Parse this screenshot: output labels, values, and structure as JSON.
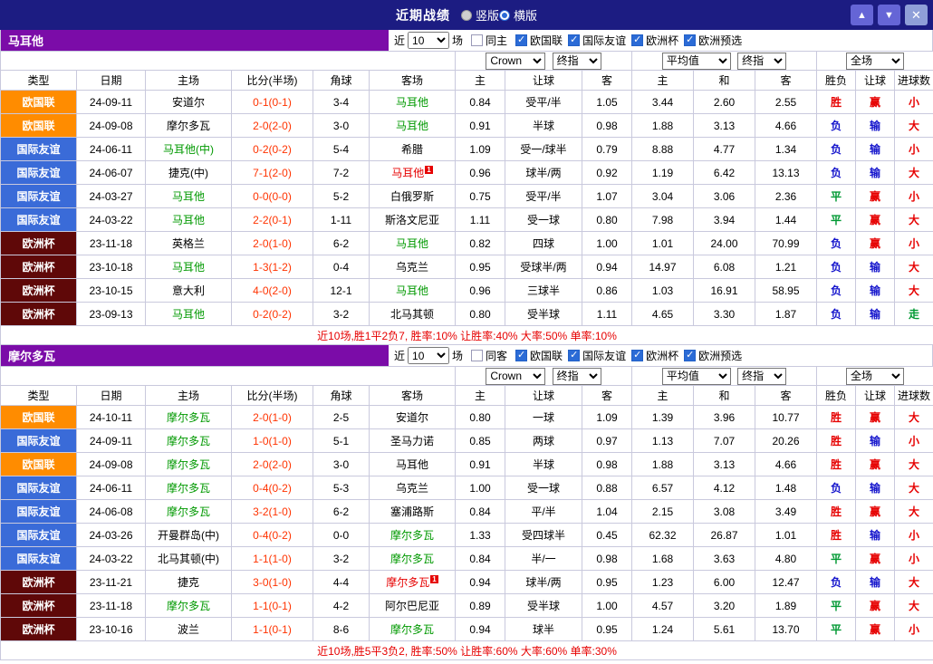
{
  "topbar": {
    "title": "近期战绩",
    "up_icon": "▲",
    "down_icon": "▼",
    "close_icon": "✕",
    "layout_options": [
      {
        "label": "竖版",
        "selected": false
      },
      {
        "label": "横版",
        "selected": true
      }
    ]
  },
  "table": {
    "columns": [
      "类型",
      "日期",
      "主场",
      "比分(半场)",
      "角球",
      "客场",
      "主",
      "让球",
      "客",
      "主",
      "和",
      "客",
      "胜负",
      "让球",
      "进球数"
    ],
    "selects": {
      "bookmaker": "Crown",
      "odds_stage": "终指",
      "average": "平均值",
      "average_stage": "终指",
      "scope": "全场"
    }
  },
  "sections": [
    {
      "team": "马耳他",
      "filter": {
        "near_label": "近",
        "count": "10",
        "unit_label": "场",
        "same_label": "同主",
        "same_checked": false,
        "leagues": [
          {
            "label": "欧国联",
            "checked": true
          },
          {
            "label": "国际友谊",
            "checked": true
          },
          {
            "label": "欧洲杯",
            "checked": true
          },
          {
            "label": "欧洲预选",
            "checked": true
          }
        ]
      },
      "rows": [
        {
          "league": "欧国联",
          "date": "24-09-11",
          "home": {
            "name": "安道尔"
          },
          "score": "0-1(0-1)",
          "corner": "3-4",
          "away": {
            "name": "马耳他",
            "style": "focus"
          },
          "o_home": "0.84",
          "handicap": "受平/半",
          "o_away": "1.05",
          "avg_home": "3.44",
          "avg_draw": "2.60",
          "avg_away": "2.55",
          "outcome": [
            "胜",
            "red"
          ],
          "hcp_result": [
            "赢",
            "red"
          ],
          "goals_result": [
            "小",
            "red"
          ]
        },
        {
          "league": "欧国联",
          "date": "24-09-08",
          "home": {
            "name": "摩尔多瓦"
          },
          "score": "2-0(2-0)",
          "corner": "3-0",
          "away": {
            "name": "马耳他",
            "style": "focus"
          },
          "o_home": "0.91",
          "handicap": "半球",
          "o_away": "0.98",
          "avg_home": "1.88",
          "avg_draw": "3.13",
          "avg_away": "4.66",
          "outcome": [
            "负",
            "blue"
          ],
          "hcp_result": [
            "输",
            "blue"
          ],
          "goals_result": [
            "大",
            "red"
          ]
        },
        {
          "league": "国际友谊",
          "date": "24-06-11",
          "home": {
            "name": "马耳他(中)",
            "style": "focus"
          },
          "score": "0-2(0-2)",
          "corner": "5-4",
          "away": {
            "name": "希腊"
          },
          "o_home": "1.09",
          "handicap": "受一/球半",
          "o_away": "0.79",
          "avg_home": "8.88",
          "avg_draw": "4.77",
          "avg_away": "1.34",
          "outcome": [
            "负",
            "blue"
          ],
          "hcp_result": [
            "输",
            "blue"
          ],
          "goals_result": [
            "小",
            "red"
          ]
        },
        {
          "league": "国际友谊",
          "date": "24-06-07",
          "home": {
            "name": "捷克(中)"
          },
          "score": "7-1(2-0)",
          "corner": "7-2",
          "away": {
            "name": "马耳他",
            "style": "red1",
            "card": "1"
          },
          "o_home": "0.96",
          "handicap": "球半/两",
          "o_away": "0.92",
          "avg_home": "1.19",
          "avg_draw": "6.42",
          "avg_away": "13.13",
          "outcome": [
            "负",
            "blue"
          ],
          "hcp_result": [
            "输",
            "blue"
          ],
          "goals_result": [
            "大",
            "red"
          ]
        },
        {
          "league": "国际友谊",
          "date": "24-03-27",
          "home": {
            "name": "马耳他",
            "style": "focus"
          },
          "score": "0-0(0-0)",
          "corner": "5-2",
          "away": {
            "name": "白俄罗斯"
          },
          "o_home": "0.75",
          "handicap": "受平/半",
          "o_away": "1.07",
          "avg_home": "3.04",
          "avg_draw": "3.06",
          "avg_away": "2.36",
          "outcome": [
            "平",
            "green"
          ],
          "hcp_result": [
            "赢",
            "red"
          ],
          "goals_result": [
            "小",
            "red"
          ]
        },
        {
          "league": "国际友谊",
          "date": "24-03-22",
          "home": {
            "name": "马耳他",
            "style": "focus"
          },
          "score": "2-2(0-1)",
          "corner": "1-11",
          "away": {
            "name": "斯洛文尼亚"
          },
          "o_home": "1.11",
          "handicap": "受一球",
          "o_away": "0.80",
          "avg_home": "7.98",
          "avg_draw": "3.94",
          "avg_away": "1.44",
          "outcome": [
            "平",
            "green"
          ],
          "hcp_result": [
            "赢",
            "red"
          ],
          "goals_result": [
            "大",
            "red"
          ]
        },
        {
          "league": "欧洲杯",
          "date": "23-11-18",
          "home": {
            "name": "英格兰"
          },
          "score": "2-0(1-0)",
          "corner": "6-2",
          "away": {
            "name": "马耳他",
            "style": "focus"
          },
          "o_home": "0.82",
          "handicap": "四球",
          "o_away": "1.00",
          "avg_home": "1.01",
          "avg_draw": "24.00",
          "avg_away": "70.99",
          "outcome": [
            "负",
            "blue"
          ],
          "hcp_result": [
            "赢",
            "red"
          ],
          "goals_result": [
            "小",
            "red"
          ]
        },
        {
          "league": "欧洲杯",
          "date": "23-10-18",
          "home": {
            "name": "马耳他",
            "style": "focus"
          },
          "score": "1-3(1-2)",
          "corner": "0-4",
          "away": {
            "name": "乌克兰"
          },
          "o_home": "0.95",
          "handicap": "受球半/两",
          "o_away": "0.94",
          "avg_home": "14.97",
          "avg_draw": "6.08",
          "avg_away": "1.21",
          "outcome": [
            "负",
            "blue"
          ],
          "hcp_result": [
            "输",
            "blue"
          ],
          "goals_result": [
            "大",
            "red"
          ]
        },
        {
          "league": "欧洲杯",
          "date": "23-10-15",
          "home": {
            "name": "意大利"
          },
          "score": "4-0(2-0)",
          "corner": "12-1",
          "away": {
            "name": "马耳他",
            "style": "focus"
          },
          "o_home": "0.96",
          "handicap": "三球半",
          "o_away": "0.86",
          "avg_home": "1.03",
          "avg_draw": "16.91",
          "avg_away": "58.95",
          "outcome": [
            "负",
            "blue"
          ],
          "hcp_result": [
            "输",
            "blue"
          ],
          "goals_result": [
            "大",
            "red"
          ]
        },
        {
          "league": "欧洲杯",
          "date": "23-09-13",
          "home": {
            "name": "马耳他",
            "style": "focus"
          },
          "score": "0-2(0-2)",
          "corner": "3-2",
          "away": {
            "name": "北马其顿"
          },
          "o_home": "0.80",
          "handicap": "受半球",
          "o_away": "1.11",
          "avg_home": "4.65",
          "avg_draw": "3.30",
          "avg_away": "1.87",
          "outcome": [
            "负",
            "blue"
          ],
          "hcp_result": [
            "输",
            "blue"
          ],
          "goals_result": [
            "走",
            "green"
          ]
        }
      ],
      "footer": "近10场,胜1平2负7, 胜率:10% 让胜率:40% 大率:50% 单率:10%"
    },
    {
      "team": "摩尔多瓦",
      "filter": {
        "near_label": "近",
        "count": "10",
        "unit_label": "场",
        "same_label": "同客",
        "same_checked": false,
        "leagues": [
          {
            "label": "欧国联",
            "checked": true
          },
          {
            "label": "国际友谊",
            "checked": true
          },
          {
            "label": "欧洲杯",
            "checked": true
          },
          {
            "label": "欧洲预选",
            "checked": true
          }
        ]
      },
      "rows": [
        {
          "league": "欧国联",
          "date": "24-10-11",
          "home": {
            "name": "摩尔多瓦",
            "style": "focus"
          },
          "score": "2-0(1-0)",
          "corner": "2-5",
          "away": {
            "name": "安道尔"
          },
          "o_home": "0.80",
          "handicap": "一球",
          "o_away": "1.09",
          "avg_home": "1.39",
          "avg_draw": "3.96",
          "avg_away": "10.77",
          "outcome": [
            "胜",
            "red"
          ],
          "hcp_result": [
            "赢",
            "red"
          ],
          "goals_result": [
            "大",
            "red"
          ]
        },
        {
          "league": "国际友谊",
          "date": "24-09-11",
          "home": {
            "name": "摩尔多瓦",
            "style": "focus"
          },
          "score": "1-0(1-0)",
          "corner": "5-1",
          "away": {
            "name": "圣马力诺"
          },
          "o_home": "0.85",
          "handicap": "两球",
          "o_away": "0.97",
          "avg_home": "1.13",
          "avg_draw": "7.07",
          "avg_away": "20.26",
          "outcome": [
            "胜",
            "red"
          ],
          "hcp_result": [
            "输",
            "blue"
          ],
          "goals_result": [
            "小",
            "red"
          ]
        },
        {
          "league": "欧国联",
          "date": "24-09-08",
          "home": {
            "name": "摩尔多瓦",
            "style": "focus"
          },
          "score": "2-0(2-0)",
          "corner": "3-0",
          "away": {
            "name": "马耳他"
          },
          "o_home": "0.91",
          "handicap": "半球",
          "o_away": "0.98",
          "avg_home": "1.88",
          "avg_draw": "3.13",
          "avg_away": "4.66",
          "outcome": [
            "胜",
            "red"
          ],
          "hcp_result": [
            "赢",
            "red"
          ],
          "goals_result": [
            "大",
            "red"
          ]
        },
        {
          "league": "国际友谊",
          "date": "24-06-11",
          "home": {
            "name": "摩尔多瓦",
            "style": "focus"
          },
          "score": "0-4(0-2)",
          "corner": "5-3",
          "away": {
            "name": "乌克兰"
          },
          "o_home": "1.00",
          "handicap": "受一球",
          "o_away": "0.88",
          "avg_home": "6.57",
          "avg_draw": "4.12",
          "avg_away": "1.48",
          "outcome": [
            "负",
            "blue"
          ],
          "hcp_result": [
            "输",
            "blue"
          ],
          "goals_result": [
            "大",
            "red"
          ]
        },
        {
          "league": "国际友谊",
          "date": "24-06-08",
          "home": {
            "name": "摩尔多瓦",
            "style": "focus"
          },
          "score": "3-2(1-0)",
          "corner": "6-2",
          "away": {
            "name": "塞浦路斯"
          },
          "o_home": "0.84",
          "handicap": "平/半",
          "o_away": "1.04",
          "avg_home": "2.15",
          "avg_draw": "3.08",
          "avg_away": "3.49",
          "outcome": [
            "胜",
            "red"
          ],
          "hcp_result": [
            "赢",
            "red"
          ],
          "goals_result": [
            "大",
            "red"
          ]
        },
        {
          "league": "国际友谊",
          "date": "24-03-26",
          "home": {
            "name": "开曼群岛(中)"
          },
          "score": "0-4(0-2)",
          "corner": "0-0",
          "away": {
            "name": "摩尔多瓦",
            "style": "focus"
          },
          "o_home": "1.33",
          "handicap": "受四球半",
          "o_away": "0.45",
          "avg_home": "62.32",
          "avg_draw": "26.87",
          "avg_away": "1.01",
          "outcome": [
            "胜",
            "red"
          ],
          "hcp_result": [
            "输",
            "blue"
          ],
          "goals_result": [
            "小",
            "red"
          ]
        },
        {
          "league": "国际友谊",
          "date": "24-03-22",
          "home": {
            "name": "北马其顿(中)"
          },
          "score": "1-1(1-0)",
          "corner": "3-2",
          "away": {
            "name": "摩尔多瓦",
            "style": "focus"
          },
          "o_home": "0.84",
          "handicap": "半/一",
          "o_away": "0.98",
          "avg_home": "1.68",
          "avg_draw": "3.63",
          "avg_away": "4.80",
          "outcome": [
            "平",
            "green"
          ],
          "hcp_result": [
            "赢",
            "red"
          ],
          "goals_result": [
            "小",
            "red"
          ]
        },
        {
          "league": "欧洲杯",
          "date": "23-11-21",
          "home": {
            "name": "捷克"
          },
          "score": "3-0(1-0)",
          "corner": "4-4",
          "away": {
            "name": "摩尔多瓦",
            "style": "red1",
            "card": "1"
          },
          "o_home": "0.94",
          "handicap": "球半/两",
          "o_away": "0.95",
          "avg_home": "1.23",
          "avg_draw": "6.00",
          "avg_away": "12.47",
          "outcome": [
            "负",
            "blue"
          ],
          "hcp_result": [
            "输",
            "blue"
          ],
          "goals_result": [
            "大",
            "red"
          ]
        },
        {
          "league": "欧洲杯",
          "date": "23-11-18",
          "home": {
            "name": "摩尔多瓦",
            "style": "focus"
          },
          "score": "1-1(0-1)",
          "corner": "4-2",
          "away": {
            "name": "阿尔巴尼亚"
          },
          "o_home": "0.89",
          "handicap": "受半球",
          "o_away": "1.00",
          "avg_home": "4.57",
          "avg_draw": "3.20",
          "avg_away": "1.89",
          "outcome": [
            "平",
            "green"
          ],
          "hcp_result": [
            "赢",
            "red"
          ],
          "goals_result": [
            "大",
            "red"
          ]
        },
        {
          "league": "欧洲杯",
          "date": "23-10-16",
          "home": {
            "name": "波兰"
          },
          "score": "1-1(0-1)",
          "corner": "8-6",
          "away": {
            "name": "摩尔多瓦",
            "style": "focus"
          },
          "o_home": "0.94",
          "handicap": "球半",
          "o_away": "0.95",
          "avg_home": "1.24",
          "avg_draw": "5.61",
          "avg_away": "13.70",
          "outcome": [
            "平",
            "green"
          ],
          "hcp_result": [
            "赢",
            "red"
          ],
          "goals_result": [
            "小",
            "red"
          ]
        }
      ],
      "footer": "近10场,胜5平3负2, 胜率:50% 让胜率:60% 大率:60% 单率:30%"
    }
  ],
  "colors": {
    "topbar_bg": "#1c1c82",
    "button_bg": "#6565d6",
    "close_button_bg": "#8f9fd8",
    "team_bar_bg": "#7b0ca8",
    "border": "#c9c9dd",
    "score": "#ff3300",
    "footer_text": "#e60000",
    "focus_team": "#009900",
    "red_card_team": "#e60000",
    "red": "#e60000",
    "blue": "#1414cc",
    "green": "#009933",
    "league": {
      "欧国联": "#ff8c00",
      "国际友谊": "#3a6bd8",
      "欧洲杯": "#5f0808"
    }
  }
}
